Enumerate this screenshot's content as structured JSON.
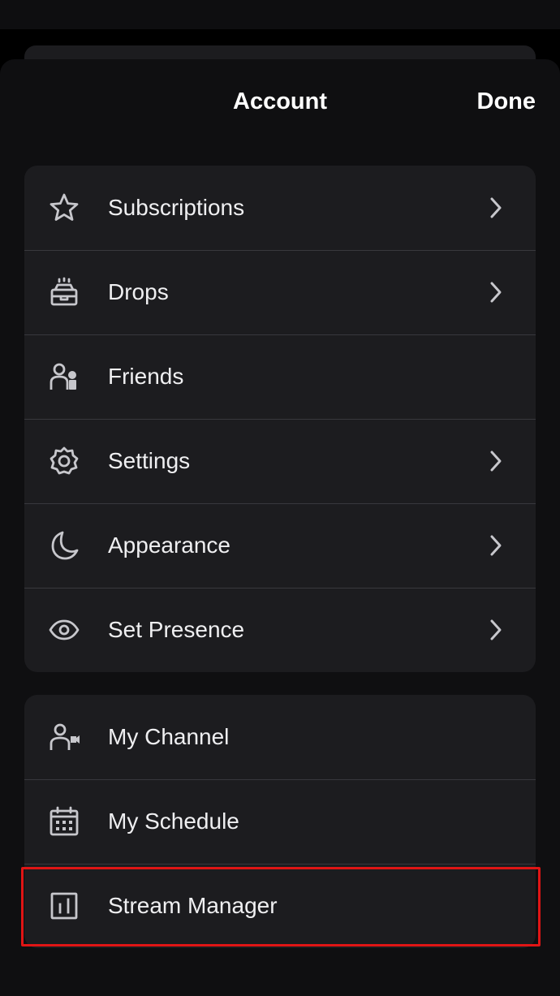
{
  "header": {
    "title": "Account",
    "done_label": "Done"
  },
  "account_group": {
    "items": [
      {
        "label": "Subscriptions",
        "icon": "star-icon",
        "has_chevron": true
      },
      {
        "label": "Drops",
        "icon": "drops-icon",
        "has_chevron": true
      },
      {
        "label": "Friends",
        "icon": "friends-icon",
        "has_chevron": false
      },
      {
        "label": "Settings",
        "icon": "gear-icon",
        "has_chevron": true
      },
      {
        "label": "Appearance",
        "icon": "moon-icon",
        "has_chevron": true
      },
      {
        "label": "Set Presence",
        "icon": "eye-icon",
        "has_chevron": true
      }
    ]
  },
  "creator_group": {
    "items": [
      {
        "label": "My Channel",
        "icon": "channel-icon"
      },
      {
        "label": "My Schedule",
        "icon": "calendar-icon"
      },
      {
        "label": "Stream Manager",
        "icon": "bar-chart-icon"
      }
    ]
  },
  "colors": {
    "background": "#0f0f11",
    "card": "#1c1c1f",
    "highlight": "#e01515",
    "text": "#efeff1"
  }
}
